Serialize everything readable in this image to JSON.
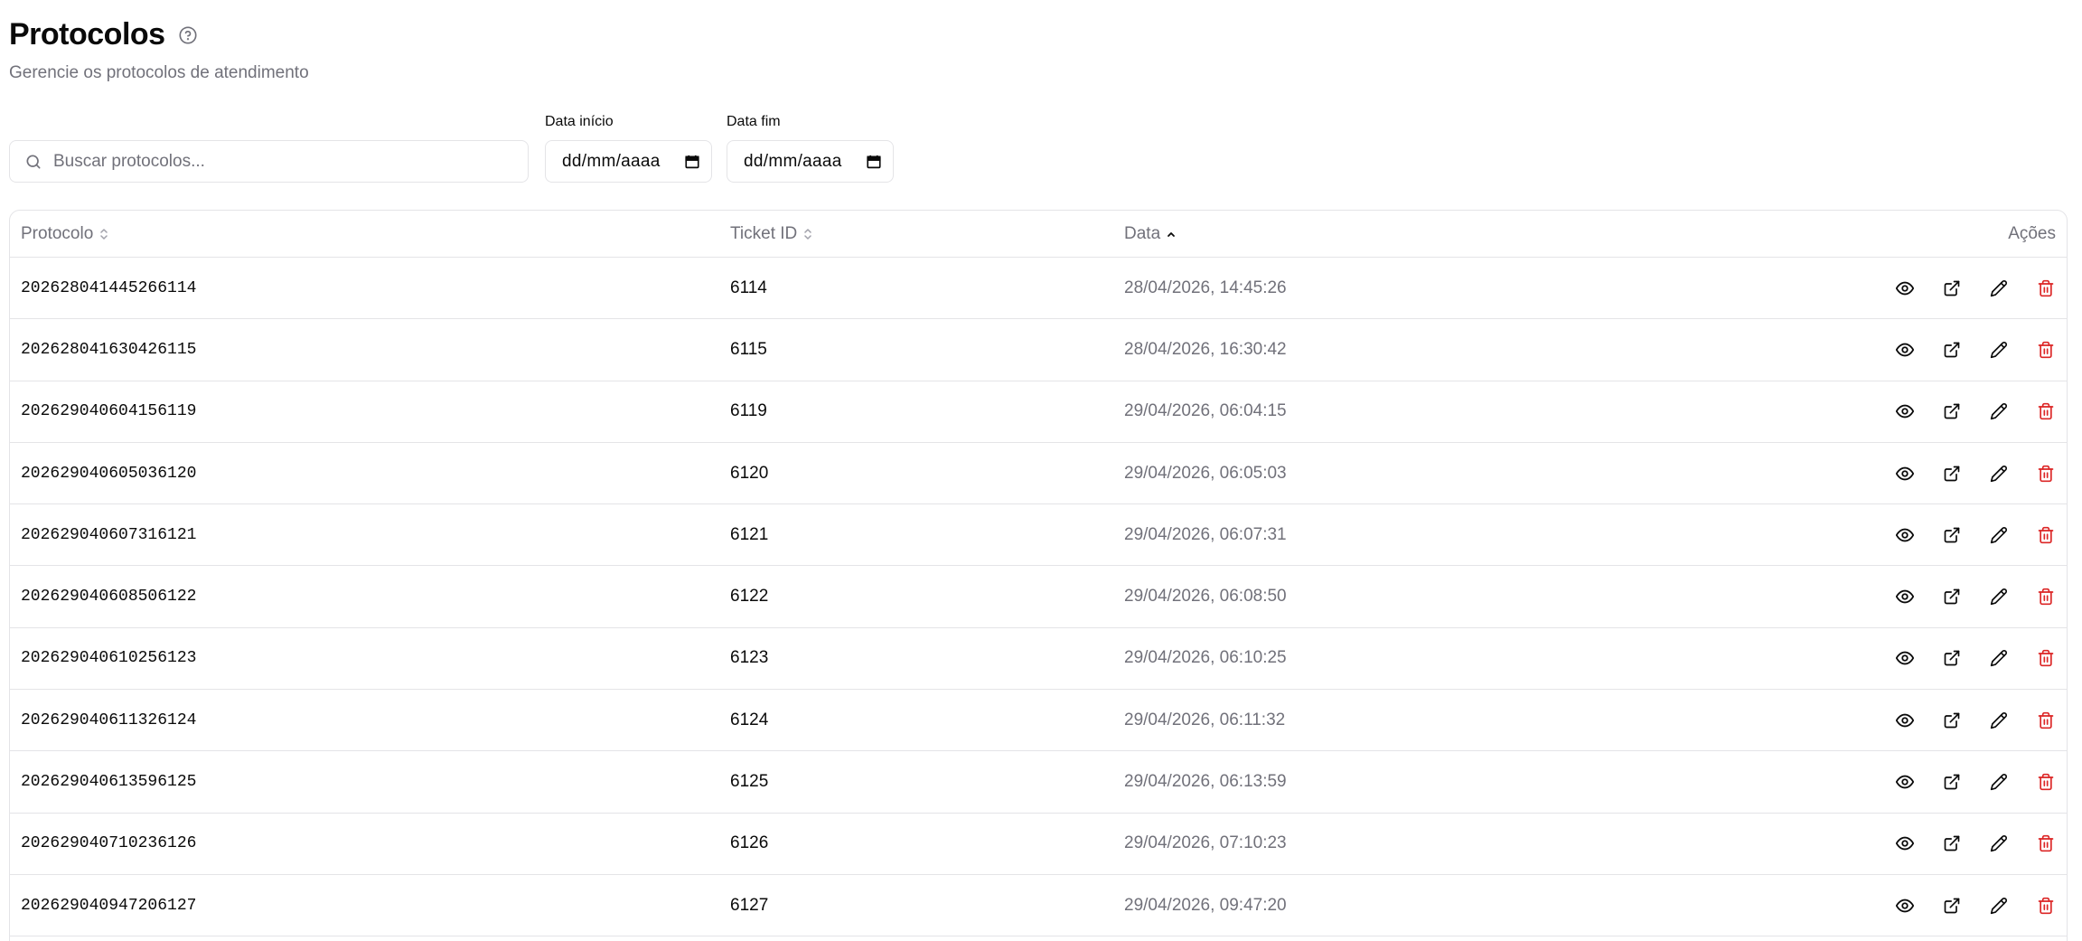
{
  "header": {
    "title": "Protocolos",
    "subtitle": "Gerencie os protocolos de atendimento"
  },
  "filters": {
    "search_placeholder": "Buscar protocolos...",
    "start_label": "Data início",
    "start_value": "dd/mm/aaaa",
    "end_label": "Data fim",
    "end_value": "dd/mm/aaaa"
  },
  "table": {
    "columns": {
      "protocol": "Protocolo",
      "ticket": "Ticket ID",
      "date": "Data",
      "actions": "Ações"
    },
    "sort": {
      "column": "date",
      "direction": "asc"
    },
    "rows": [
      {
        "protocol": "202628041445266114",
        "ticket": "6114",
        "date": "28/04/2026, 14:45:26"
      },
      {
        "protocol": "202628041630426115",
        "ticket": "6115",
        "date": "28/04/2026, 16:30:42"
      },
      {
        "protocol": "202629040604156119",
        "ticket": "6119",
        "date": "29/04/2026, 06:04:15"
      },
      {
        "protocol": "202629040605036120",
        "ticket": "6120",
        "date": "29/04/2026, 06:05:03"
      },
      {
        "protocol": "202629040607316121",
        "ticket": "6121",
        "date": "29/04/2026, 06:07:31"
      },
      {
        "protocol": "202629040608506122",
        "ticket": "6122",
        "date": "29/04/2026, 06:08:50"
      },
      {
        "protocol": "202629040610256123",
        "ticket": "6123",
        "date": "29/04/2026, 06:10:25"
      },
      {
        "protocol": "202629040611326124",
        "ticket": "6124",
        "date": "29/04/2026, 06:11:32"
      },
      {
        "protocol": "202629040613596125",
        "ticket": "6125",
        "date": "29/04/2026, 06:13:59"
      },
      {
        "protocol": "202629040710236126",
        "ticket": "6126",
        "date": "29/04/2026, 07:10:23"
      },
      {
        "protocol": "202629040947206127",
        "ticket": "6127",
        "date": "29/04/2026, 09:47:20"
      }
    ]
  },
  "icons": {
    "help": "help-circle-icon",
    "search": "search-icon",
    "calendar": "calendar-icon",
    "view": "eye-icon",
    "open": "external-link-icon",
    "edit": "pencil-icon",
    "delete": "trash-icon"
  },
  "colors": {
    "text": "#0a0a0a",
    "muted": "#71717a",
    "border": "#e4e4e7",
    "danger": "#dc2626"
  }
}
